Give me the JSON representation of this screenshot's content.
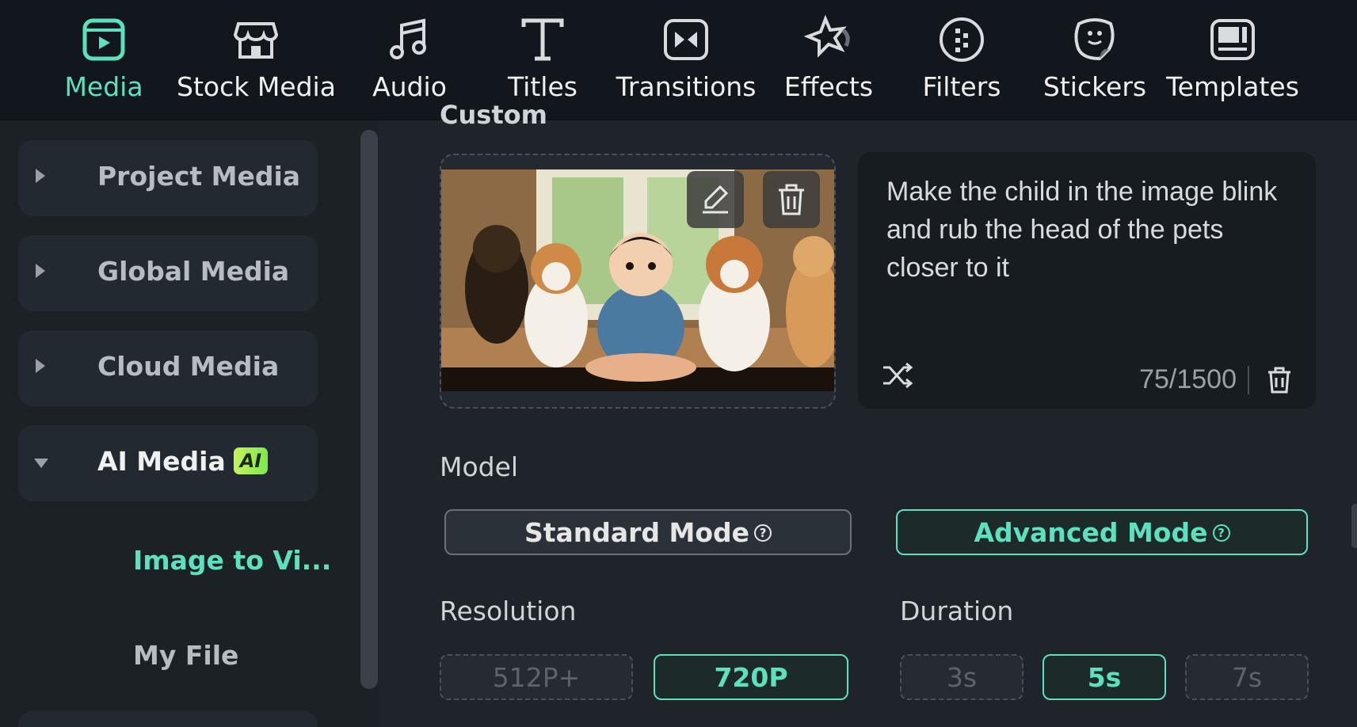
{
  "toolbar": {
    "tabs": [
      {
        "label": "Media",
        "icon": "media-icon",
        "active": true
      },
      {
        "label": "Stock Media",
        "icon": "stock-media-icon",
        "active": false
      },
      {
        "label": "Audio",
        "icon": "music-note-icon",
        "active": false
      },
      {
        "label": "Titles",
        "icon": "text-icon",
        "active": false
      },
      {
        "label": "Transitions",
        "icon": "transitions-icon",
        "active": false
      },
      {
        "label": "Effects",
        "icon": "effects-star-icon",
        "active": false
      },
      {
        "label": "Filters",
        "icon": "filters-icon",
        "active": false
      },
      {
        "label": "Stickers",
        "icon": "sticker-icon",
        "active": false
      },
      {
        "label": "Templates",
        "icon": "templates-icon",
        "active": false
      }
    ]
  },
  "sidebar": {
    "items": [
      {
        "label": "Project Media",
        "expanded": false
      },
      {
        "label": "Global Media",
        "expanded": false
      },
      {
        "label": "Cloud Media",
        "expanded": false
      },
      {
        "label": "AI Media",
        "expanded": true,
        "badge": "AI"
      }
    ],
    "sub_items": [
      {
        "label": "Image to Vi...",
        "active": true
      },
      {
        "label": "My File",
        "active": false
      }
    ]
  },
  "main": {
    "section_title": "Custom",
    "prompt": {
      "text": "Make the child in the image blink and rub the head of the pets closer to it",
      "counter": "75/1500"
    },
    "model": {
      "label": "Model",
      "options": [
        {
          "label": "Standard Mode",
          "selected": false
        },
        {
          "label": "Advanced Mode",
          "selected": true
        }
      ]
    },
    "resolution": {
      "label": "Resolution",
      "options": [
        {
          "label": "512P+",
          "state": "disabled"
        },
        {
          "label": "720P",
          "state": "selected"
        }
      ]
    },
    "duration": {
      "label": "Duration",
      "options": [
        {
          "label": "3s",
          "state": "disabled"
        },
        {
          "label": "5s",
          "state": "selected"
        },
        {
          "label": "7s",
          "state": "disabled"
        }
      ]
    }
  },
  "colors": {
    "accent": "#5de0bd",
    "toolbar_bg": "#12171d",
    "panel_bg": "#1f242a"
  }
}
